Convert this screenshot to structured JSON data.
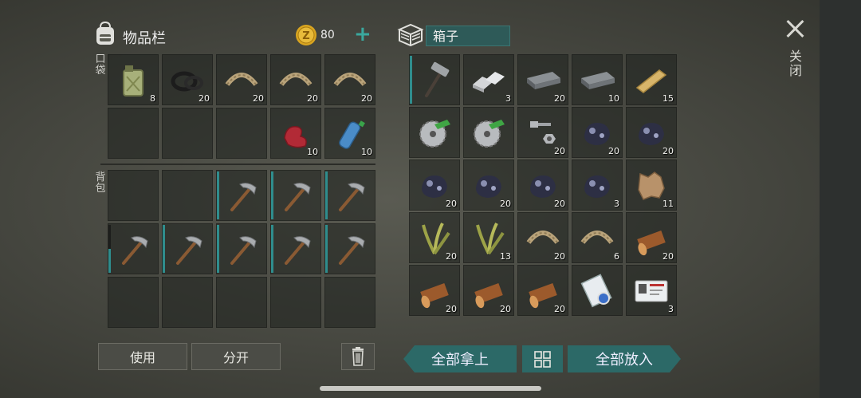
{
  "inventory": {
    "title": "物品栏",
    "coins": "80",
    "pocket_label": "口袋",
    "backpack_label": "背包"
  },
  "box": {
    "name": "箱子"
  },
  "close_label": "关闭",
  "buttons": {
    "use": "使用",
    "split": "分开",
    "take_all": "全部拿上",
    "put_all": "全部放入"
  },
  "colors": {
    "accent_teal": "#2c6967",
    "durability": "#2f8d8d",
    "coin": "#d9a520"
  },
  "pocket_slots": [
    {
      "item": "fuel-canister",
      "count": "8"
    },
    {
      "item": "tire",
      "count": "20"
    },
    {
      "item": "rope",
      "count": "20"
    },
    {
      "item": "rope",
      "count": "20"
    },
    {
      "item": "rope",
      "count": "20"
    },
    {
      "item": "",
      "count": ""
    },
    {
      "item": "",
      "count": ""
    },
    {
      "item": "",
      "count": ""
    },
    {
      "item": "raw-meat",
      "count": "10"
    },
    {
      "item": "water-bottle",
      "count": "10"
    }
  ],
  "backpack_slots": [
    {
      "item": "",
      "count": ""
    },
    {
      "item": "",
      "count": ""
    },
    {
      "item": "pickaxe",
      "count": "",
      "durability": 1.0
    },
    {
      "item": "pickaxe",
      "count": "",
      "durability": 1.0
    },
    {
      "item": "pickaxe",
      "count": "",
      "durability": 1.0
    },
    {
      "item": "pickaxe",
      "count": "",
      "durability": 0.5
    },
    {
      "item": "pickaxe",
      "count": "",
      "durability": 1.0
    },
    {
      "item": "pickaxe",
      "count": "",
      "durability": 1.0
    },
    {
      "item": "pickaxe",
      "count": "",
      "durability": 1.0
    },
    {
      "item": "pickaxe",
      "count": "",
      "durability": 1.0
    },
    {
      "item": "",
      "count": ""
    },
    {
      "item": "",
      "count": ""
    },
    {
      "item": "",
      "count": ""
    },
    {
      "item": "",
      "count": ""
    },
    {
      "item": "",
      "count": ""
    }
  ],
  "box_slots": [
    {
      "item": "hammer",
      "count": "",
      "durability": 1.0
    },
    {
      "item": "aluminum-ingot",
      "count": "3"
    },
    {
      "item": "iron-ingot",
      "count": "20"
    },
    {
      "item": "iron-ingot",
      "count": "10"
    },
    {
      "item": "wood-plank",
      "count": "15"
    },
    {
      "item": "saw-blade",
      "count": ""
    },
    {
      "item": "saw-blade",
      "count": ""
    },
    {
      "item": "nuts-bolts",
      "count": "20"
    },
    {
      "item": "iron-ore",
      "count": "20"
    },
    {
      "item": "iron-ore",
      "count": "20"
    },
    {
      "item": "iron-ore",
      "count": "20"
    },
    {
      "item": "iron-ore",
      "count": "20"
    },
    {
      "item": "iron-ore",
      "count": "20"
    },
    {
      "item": "iron-ore",
      "count": "3"
    },
    {
      "item": "animal-hide",
      "count": "11"
    },
    {
      "item": "plant-fiber",
      "count": "20"
    },
    {
      "item": "plant-fiber",
      "count": "13"
    },
    {
      "item": "rope",
      "count": "20"
    },
    {
      "item": "rope",
      "count": "6"
    },
    {
      "item": "log",
      "count": "20"
    },
    {
      "item": "log",
      "count": "20"
    },
    {
      "item": "log",
      "count": "20"
    },
    {
      "item": "log",
      "count": "20"
    },
    {
      "item": "blueprint-scroll",
      "count": ""
    },
    {
      "item": "id-card",
      "count": "3"
    }
  ]
}
